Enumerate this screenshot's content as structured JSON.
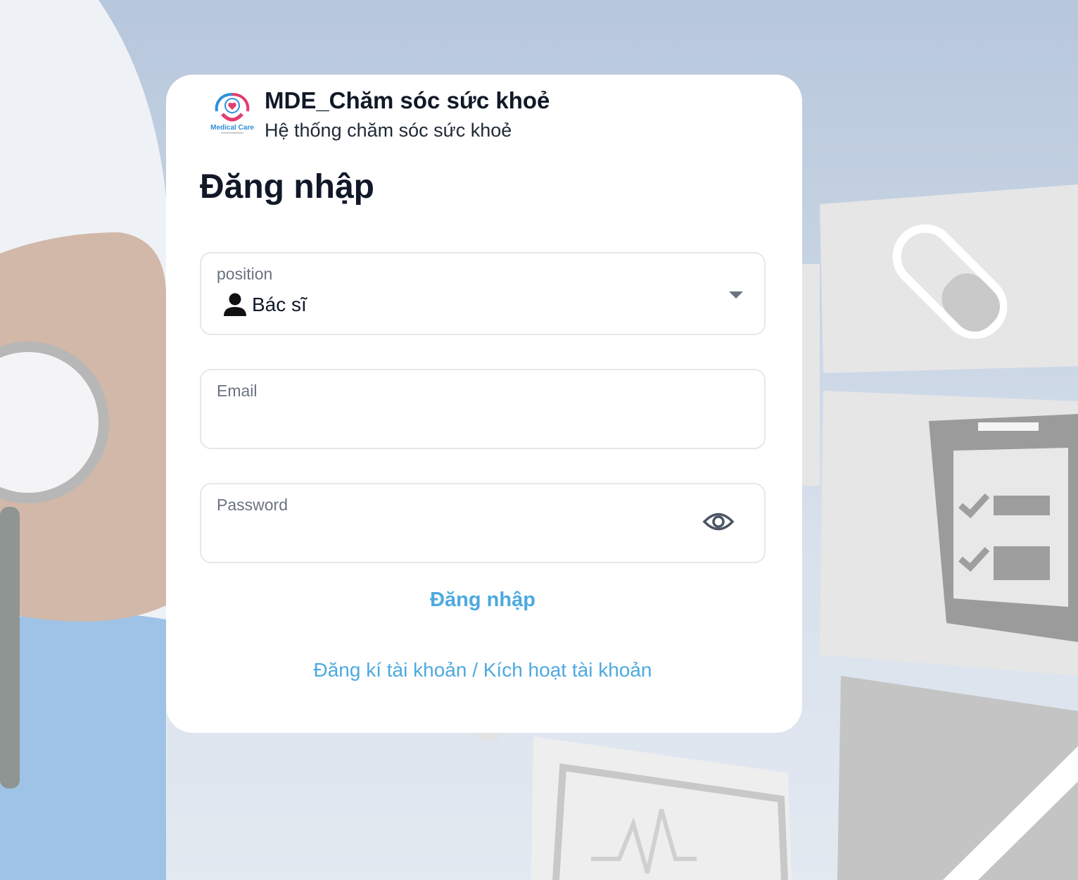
{
  "brand": {
    "logo_text": "Medical Care",
    "title": "MDE_Chăm sóc sức khoẻ",
    "subtitle": "Hệ thống chăm sóc sức khoẻ"
  },
  "form": {
    "heading": "Đăng nhập",
    "position": {
      "label": "position",
      "value": "Bác sĩ",
      "icon": "person-icon"
    },
    "email": {
      "label": "Email",
      "value": ""
    },
    "password": {
      "label": "Password",
      "value": "",
      "icon": "eye-icon"
    },
    "submit_label": "Đăng nhập",
    "register_link": "Đăng kí tài khoản / Kích hoạt tài khoản"
  },
  "colors": {
    "accent": "#4ea9df",
    "logo_pink": "#e23d6e",
    "logo_blue": "#2f8fd8"
  }
}
